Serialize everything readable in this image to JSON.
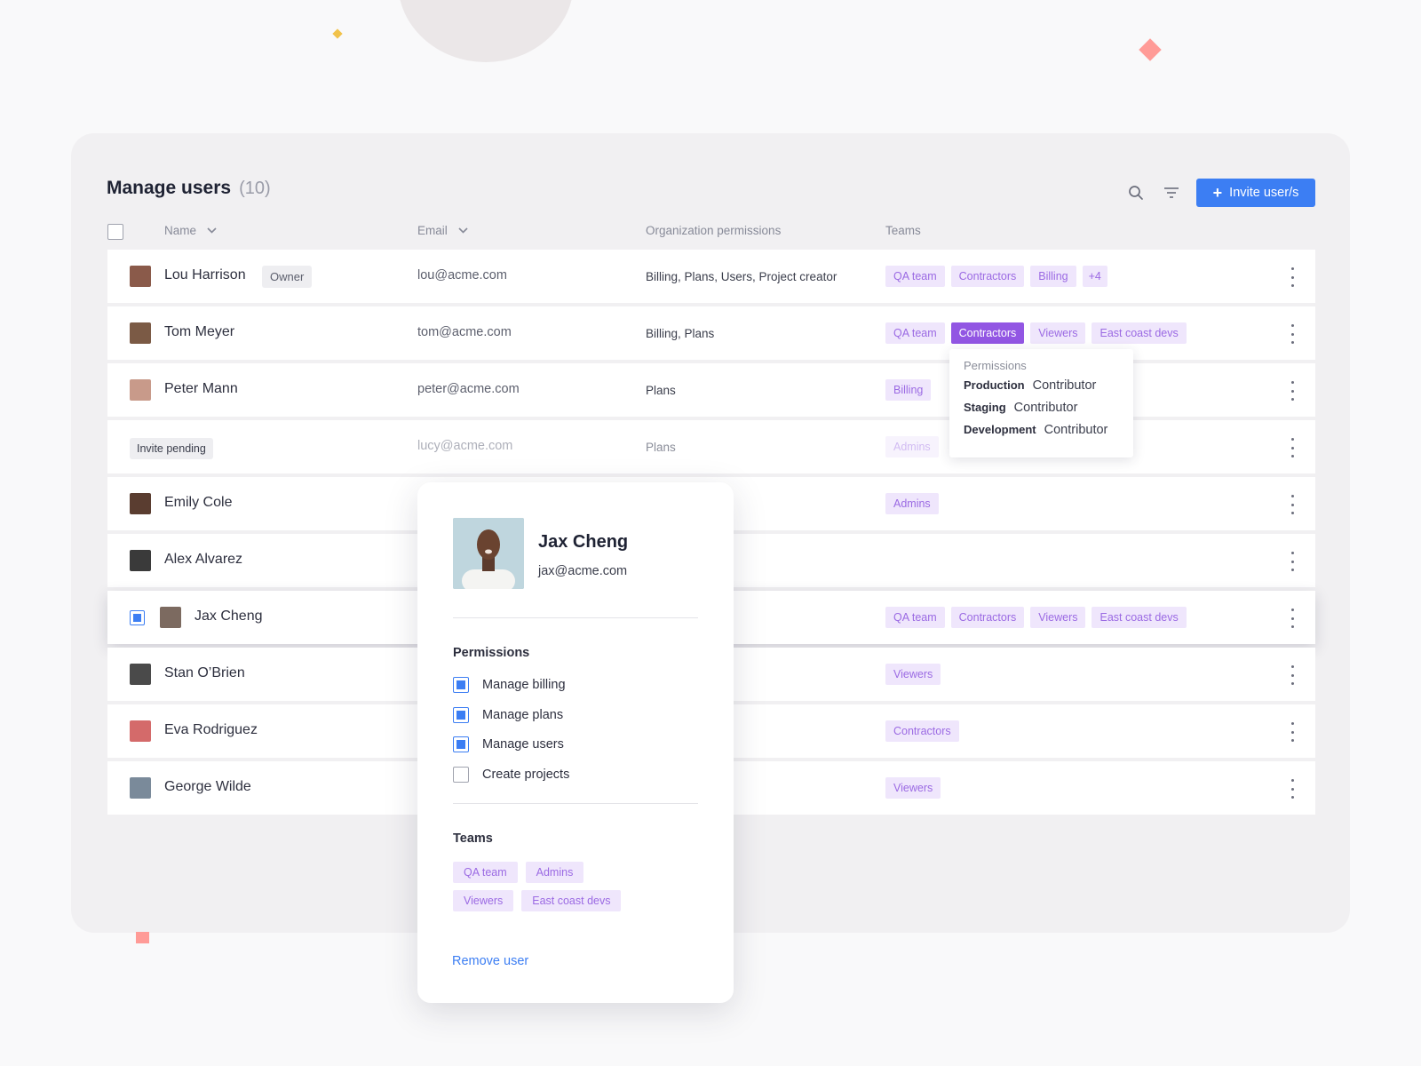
{
  "header": {
    "title": "Manage users",
    "count": "(10)",
    "invite_label": "Invite user/s"
  },
  "columns": {
    "name": "Name",
    "email": "Email",
    "permissions": "Organization permissions",
    "teams": "Teams"
  },
  "users": [
    {
      "name": "Lou Harrison",
      "badge": "Owner",
      "email": "lou@acme.com",
      "permissions": "Billing, Plans, Users, Project creator",
      "teams": [
        "QA team",
        "Contractors",
        "Billing",
        "+4"
      ],
      "avatar_color": "#8a5a4a"
    },
    {
      "name": "Tom Meyer",
      "email": "tom@acme.com",
      "permissions": "Billing, Plans",
      "teams": [
        "QA team",
        "Contractors",
        "Viewers",
        "East coast devs"
      ],
      "active_team": "Contractors",
      "avatar_color": "#7b5a45"
    },
    {
      "name": "Peter Mann",
      "email": "peter@acme.com",
      "permissions": "Plans",
      "teams": [
        "Billing"
      ],
      "avatar_color": "#c89a8a"
    },
    {
      "pending_badge": "Invite pending",
      "email": "lucy@acme.com",
      "permissions": "Plans",
      "teams": [
        "Admins"
      ]
    },
    {
      "name": "Emily Cole",
      "teams": [
        "Admins"
      ],
      "avatar_color": "#5a3d30"
    },
    {
      "name": "Alex Alvarez",
      "teams": [],
      "avatar_color": "#3a3a3a"
    },
    {
      "name": "Jax Cheng",
      "teams": [
        "QA team",
        "Contractors",
        "Viewers",
        "East coast devs"
      ],
      "selected": true,
      "avatar_color": "#7c6a60"
    },
    {
      "name": "Stan O’Brien",
      "teams": [
        "Viewers"
      ],
      "avatar_color": "#4a4a4a"
    },
    {
      "name": "Eva Rodriguez",
      "teams": [
        "Contractors"
      ],
      "avatar_color": "#d46a6a"
    },
    {
      "name": "George Wilde",
      "teams": [
        "Viewers"
      ],
      "avatar_color": "#7a8a9a"
    }
  ],
  "tooltip": {
    "title": "Permissions",
    "entries": [
      {
        "env": "Production",
        "role": "Contributor"
      },
      {
        "env": "Staging",
        "role": "Contributor"
      },
      {
        "env": "Development",
        "role": "Contributor"
      }
    ]
  },
  "user_card": {
    "name": "Jax Cheng",
    "email": "jax@acme.com",
    "permissions_title": "Permissions",
    "permissions": [
      {
        "label": "Manage billing",
        "checked": true
      },
      {
        "label": "Manage plans",
        "checked": true
      },
      {
        "label": "Manage users",
        "checked": true
      },
      {
        "label": "Create projects",
        "checked": false
      }
    ],
    "teams_title": "Teams",
    "teams": [
      "QA team",
      "Admins",
      "Viewers",
      "East coast devs"
    ],
    "remove_label": "Remove user"
  },
  "icons": {
    "search": "search-icon",
    "filter": "filter-icon",
    "plus": "plus-icon",
    "kebab": "kebab-menu-icon",
    "chevron": "chevron-down-icon"
  },
  "colors": {
    "accent": "#3c7ef3",
    "tag_bg": "#efe6fc",
    "tag_text": "#9b6ae3",
    "tag_active": "#9256e3"
  }
}
